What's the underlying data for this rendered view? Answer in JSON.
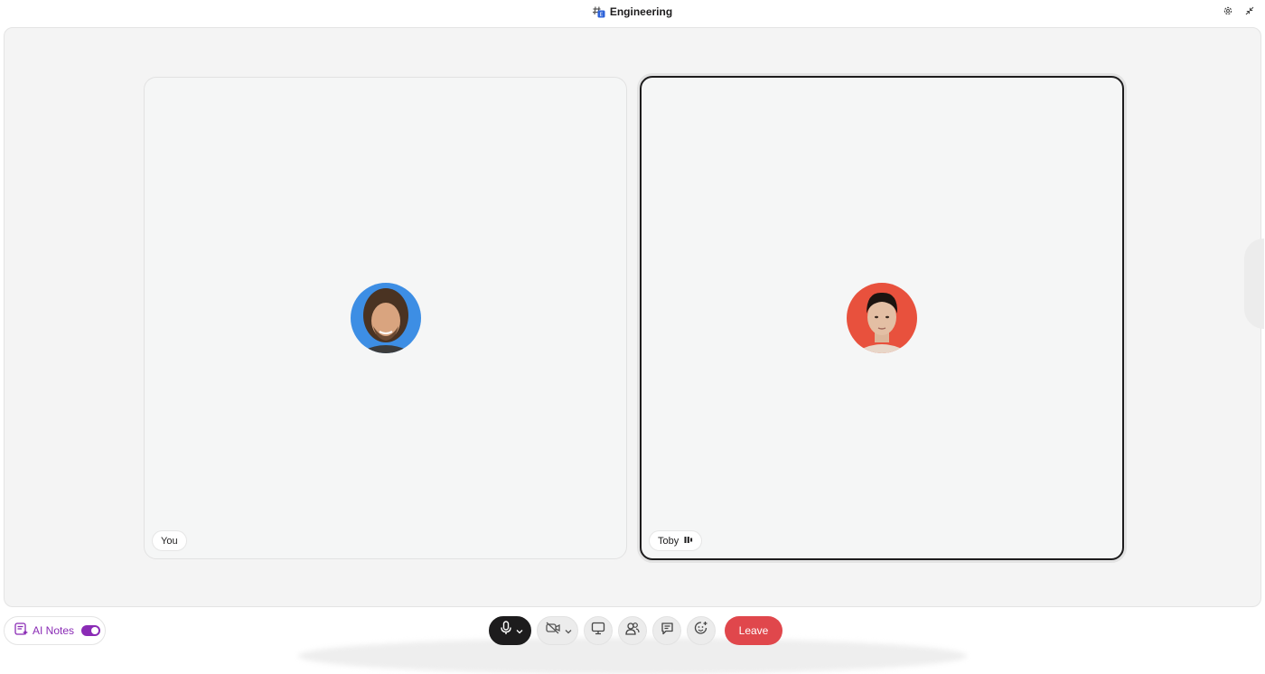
{
  "header": {
    "channel_name": "Engineering",
    "channel_icon": "hash-channel-icon"
  },
  "participants": [
    {
      "name": "You",
      "avatar_color": "#3d8ee4",
      "speaking": false
    },
    {
      "name": "Toby",
      "avatar_color": "#e8513d",
      "speaking": true,
      "speaking_icon": "audio-level-icon"
    }
  ],
  "footer": {
    "ai_notes_label": "AI Notes",
    "ai_notes_enabled": true,
    "leave_label": "Leave",
    "accent_purple": "#8a2bb5",
    "leave_color": "#e0474c"
  }
}
